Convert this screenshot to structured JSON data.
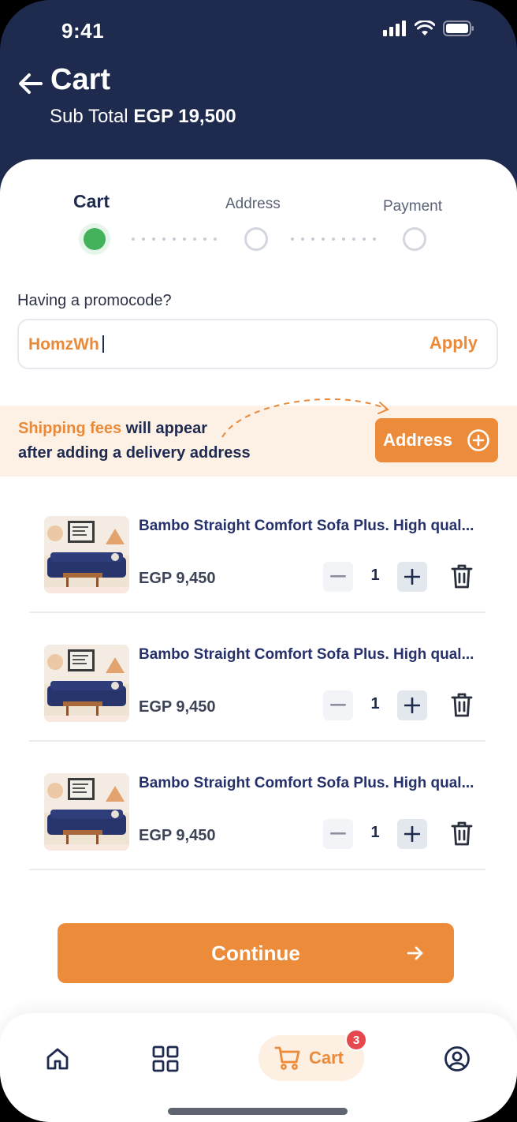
{
  "status_bar": {
    "time": "9:41",
    "icons": [
      "signal-icon",
      "wifi-icon",
      "battery-icon"
    ]
  },
  "header": {
    "title": "Cart",
    "subtotal_label": "Sub Total",
    "subtotal_value": "EGP 19,500"
  },
  "stepper": {
    "steps": [
      {
        "label": "Cart",
        "active": true
      },
      {
        "label": "Address",
        "active": false
      },
      {
        "label": "Payment",
        "active": false
      }
    ]
  },
  "promo": {
    "label": "Having a promocode?",
    "value": "HomzWh",
    "apply_label": "Apply"
  },
  "shipping_banner": {
    "highlight": "Shipping fees",
    "text_line1": " will appear",
    "text_line2": "after adding a delivery address",
    "address_button_label": "Address"
  },
  "cart_items": [
    {
      "name": "Bambo Straight Comfort Sofa Plus. High qual...",
      "price": "EGP 9,450",
      "quantity": "1"
    },
    {
      "name": "Bambo Straight Comfort Sofa Plus. High qual...",
      "price": "EGP 9,450",
      "quantity": "1"
    },
    {
      "name": "Bambo Straight Comfort Sofa Plus. High qual...",
      "price": "EGP 9,450",
      "quantity": "1"
    }
  ],
  "continue_label": "Continue",
  "bottom_nav": {
    "items": [
      "home-icon",
      "grid-icon",
      "cart-icon",
      "profile-icon"
    ],
    "cart_label": "Cart",
    "cart_badge": "3"
  },
  "colors": {
    "navy": "#1f2a4f",
    "accent": "#ec8b39",
    "success": "#43b25a",
    "badge": "#e5484d"
  }
}
